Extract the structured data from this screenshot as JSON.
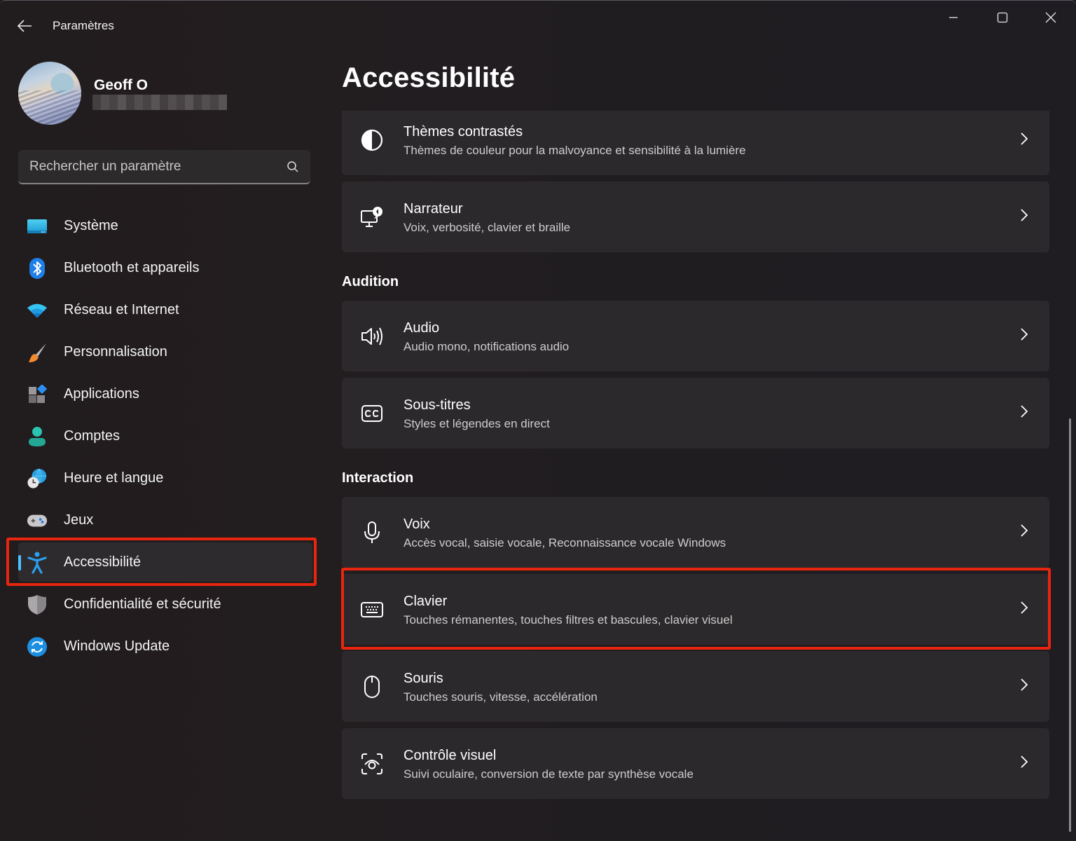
{
  "window": {
    "app_title": "Paramètres",
    "controls": {
      "minimize": "minimize",
      "maximize": "maximize",
      "close": "close"
    }
  },
  "profile": {
    "name": "Geoff O",
    "email_redacted": true
  },
  "search": {
    "placeholder": "Rechercher un paramètre",
    "value": ""
  },
  "sidebar": {
    "items": [
      {
        "label": "Système",
        "icon": "system-icon",
        "active": false
      },
      {
        "label": "Bluetooth et appareils",
        "icon": "bluetooth-icon",
        "active": false
      },
      {
        "label": "Réseau et Internet",
        "icon": "wifi-icon",
        "active": false
      },
      {
        "label": "Personnalisation",
        "icon": "paintbrush-icon",
        "active": false
      },
      {
        "label": "Applications",
        "icon": "apps-icon",
        "active": false
      },
      {
        "label": "Comptes",
        "icon": "account-icon",
        "active": false
      },
      {
        "label": "Heure et langue",
        "icon": "time-language-icon",
        "active": false
      },
      {
        "label": "Jeux",
        "icon": "gamepad-icon",
        "active": false
      },
      {
        "label": "Accessibilité",
        "icon": "accessibility-icon",
        "active": true
      },
      {
        "label": "Confidentialité et sécurité",
        "icon": "shield-icon",
        "active": false
      },
      {
        "label": "Windows Update",
        "icon": "windows-update-icon",
        "active": false
      }
    ]
  },
  "main": {
    "title": "Accessibilité",
    "groups": [
      {
        "heading": "",
        "cards": [
          {
            "title": "Thèmes contrastés",
            "subtitle": "Thèmes de couleur pour la malvoyance et sensibilité à la lumière",
            "icon": "contrast-icon"
          },
          {
            "title": "Narrateur",
            "subtitle": "Voix, verbosité, clavier et braille",
            "icon": "narrator-icon"
          }
        ]
      },
      {
        "heading": "Audition",
        "cards": [
          {
            "title": "Audio",
            "subtitle": "Audio mono, notifications audio",
            "icon": "speaker-icon"
          },
          {
            "title": "Sous-titres",
            "subtitle": "Styles et légendes en direct",
            "icon": "closed-captions-icon"
          }
        ]
      },
      {
        "heading": "Interaction",
        "cards": [
          {
            "title": "Voix",
            "subtitle": "Accès vocal, saisie vocale, Reconnaissance vocale Windows",
            "icon": "microphone-icon"
          },
          {
            "title": "Clavier",
            "subtitle": "Touches rémanentes, touches filtres et bascules, clavier visuel",
            "icon": "keyboard-icon",
            "highlighted": true
          },
          {
            "title": "Souris",
            "subtitle": "Touches souris, vitesse, accélération",
            "icon": "mouse-icon"
          },
          {
            "title": "Contrôle visuel",
            "subtitle": "Suivi oculaire, conversion de texte par synthèse vocale",
            "icon": "eye-control-icon"
          }
        ]
      }
    ]
  },
  "colors": {
    "accent": "#4cc2ff",
    "highlight_annotation": "#e8250f",
    "card_background": "#2c292c",
    "window_background": "#211d1f"
  }
}
